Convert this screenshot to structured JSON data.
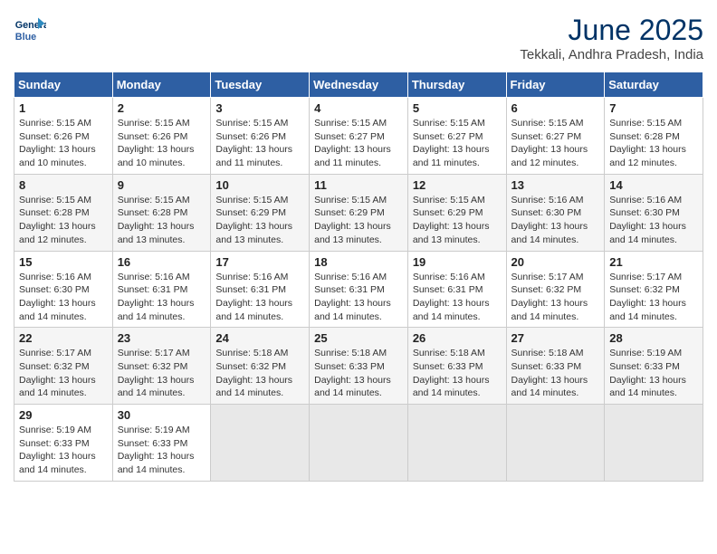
{
  "header": {
    "logo_line1": "General",
    "logo_line2": "Blue",
    "month_title": "June 2025",
    "location": "Tekkali, Andhra Pradesh, India"
  },
  "weekdays": [
    "Sunday",
    "Monday",
    "Tuesday",
    "Wednesday",
    "Thursday",
    "Friday",
    "Saturday"
  ],
  "weeks": [
    [
      {
        "day": "1",
        "sunrise": "5:15 AM",
        "sunset": "6:26 PM",
        "daylight": "13 hours and 10 minutes."
      },
      {
        "day": "2",
        "sunrise": "5:15 AM",
        "sunset": "6:26 PM",
        "daylight": "13 hours and 10 minutes."
      },
      {
        "day": "3",
        "sunrise": "5:15 AM",
        "sunset": "6:26 PM",
        "daylight": "13 hours and 11 minutes."
      },
      {
        "day": "4",
        "sunrise": "5:15 AM",
        "sunset": "6:27 PM",
        "daylight": "13 hours and 11 minutes."
      },
      {
        "day": "5",
        "sunrise": "5:15 AM",
        "sunset": "6:27 PM",
        "daylight": "13 hours and 11 minutes."
      },
      {
        "day": "6",
        "sunrise": "5:15 AM",
        "sunset": "6:27 PM",
        "daylight": "13 hours and 12 minutes."
      },
      {
        "day": "7",
        "sunrise": "5:15 AM",
        "sunset": "6:28 PM",
        "daylight": "13 hours and 12 minutes."
      }
    ],
    [
      {
        "day": "8",
        "sunrise": "5:15 AM",
        "sunset": "6:28 PM",
        "daylight": "13 hours and 12 minutes."
      },
      {
        "day": "9",
        "sunrise": "5:15 AM",
        "sunset": "6:28 PM",
        "daylight": "13 hours and 13 minutes."
      },
      {
        "day": "10",
        "sunrise": "5:15 AM",
        "sunset": "6:29 PM",
        "daylight": "13 hours and 13 minutes."
      },
      {
        "day": "11",
        "sunrise": "5:15 AM",
        "sunset": "6:29 PM",
        "daylight": "13 hours and 13 minutes."
      },
      {
        "day": "12",
        "sunrise": "5:15 AM",
        "sunset": "6:29 PM",
        "daylight": "13 hours and 13 minutes."
      },
      {
        "day": "13",
        "sunrise": "5:16 AM",
        "sunset": "6:30 PM",
        "daylight": "13 hours and 14 minutes."
      },
      {
        "day": "14",
        "sunrise": "5:16 AM",
        "sunset": "6:30 PM",
        "daylight": "13 hours and 14 minutes."
      }
    ],
    [
      {
        "day": "15",
        "sunrise": "5:16 AM",
        "sunset": "6:30 PM",
        "daylight": "13 hours and 14 minutes."
      },
      {
        "day": "16",
        "sunrise": "5:16 AM",
        "sunset": "6:31 PM",
        "daylight": "13 hours and 14 minutes."
      },
      {
        "day": "17",
        "sunrise": "5:16 AM",
        "sunset": "6:31 PM",
        "daylight": "13 hours and 14 minutes."
      },
      {
        "day": "18",
        "sunrise": "5:16 AM",
        "sunset": "6:31 PM",
        "daylight": "13 hours and 14 minutes."
      },
      {
        "day": "19",
        "sunrise": "5:16 AM",
        "sunset": "6:31 PM",
        "daylight": "13 hours and 14 minutes."
      },
      {
        "day": "20",
        "sunrise": "5:17 AM",
        "sunset": "6:32 PM",
        "daylight": "13 hours and 14 minutes."
      },
      {
        "day": "21",
        "sunrise": "5:17 AM",
        "sunset": "6:32 PM",
        "daylight": "13 hours and 14 minutes."
      }
    ],
    [
      {
        "day": "22",
        "sunrise": "5:17 AM",
        "sunset": "6:32 PM",
        "daylight": "13 hours and 14 minutes."
      },
      {
        "day": "23",
        "sunrise": "5:17 AM",
        "sunset": "6:32 PM",
        "daylight": "13 hours and 14 minutes."
      },
      {
        "day": "24",
        "sunrise": "5:18 AM",
        "sunset": "6:32 PM",
        "daylight": "13 hours and 14 minutes."
      },
      {
        "day": "25",
        "sunrise": "5:18 AM",
        "sunset": "6:33 PM",
        "daylight": "13 hours and 14 minutes."
      },
      {
        "day": "26",
        "sunrise": "5:18 AM",
        "sunset": "6:33 PM",
        "daylight": "13 hours and 14 minutes."
      },
      {
        "day": "27",
        "sunrise": "5:18 AM",
        "sunset": "6:33 PM",
        "daylight": "13 hours and 14 minutes."
      },
      {
        "day": "28",
        "sunrise": "5:19 AM",
        "sunset": "6:33 PM",
        "daylight": "13 hours and 14 minutes."
      }
    ],
    [
      {
        "day": "29",
        "sunrise": "5:19 AM",
        "sunset": "6:33 PM",
        "daylight": "13 hours and 14 minutes."
      },
      {
        "day": "30",
        "sunrise": "5:19 AM",
        "sunset": "6:33 PM",
        "daylight": "13 hours and 14 minutes."
      },
      null,
      null,
      null,
      null,
      null
    ]
  ]
}
